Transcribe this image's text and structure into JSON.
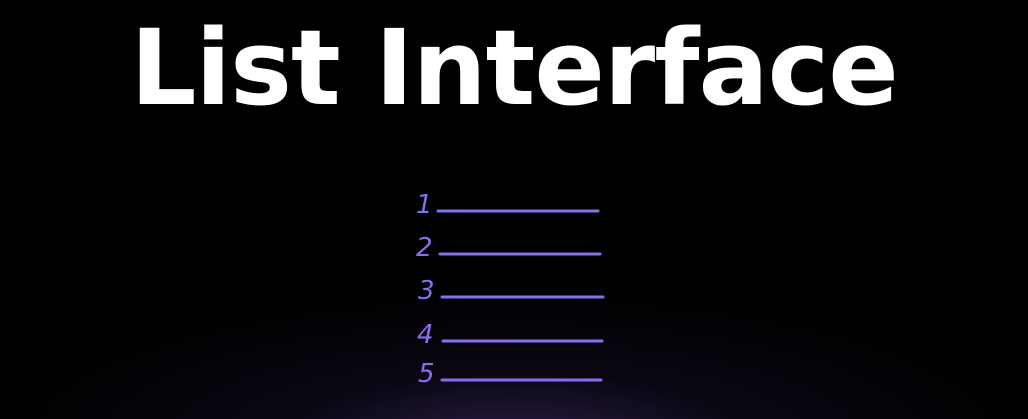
{
  "title": "List Interface",
  "colors": {
    "background": "#000000",
    "title": "#ffffff",
    "accent": "#8b6cf0"
  },
  "list": {
    "items": [
      {
        "number": "1"
      },
      {
        "number": "2"
      },
      {
        "number": "3"
      },
      {
        "number": "4"
      },
      {
        "number": "5"
      }
    ]
  }
}
